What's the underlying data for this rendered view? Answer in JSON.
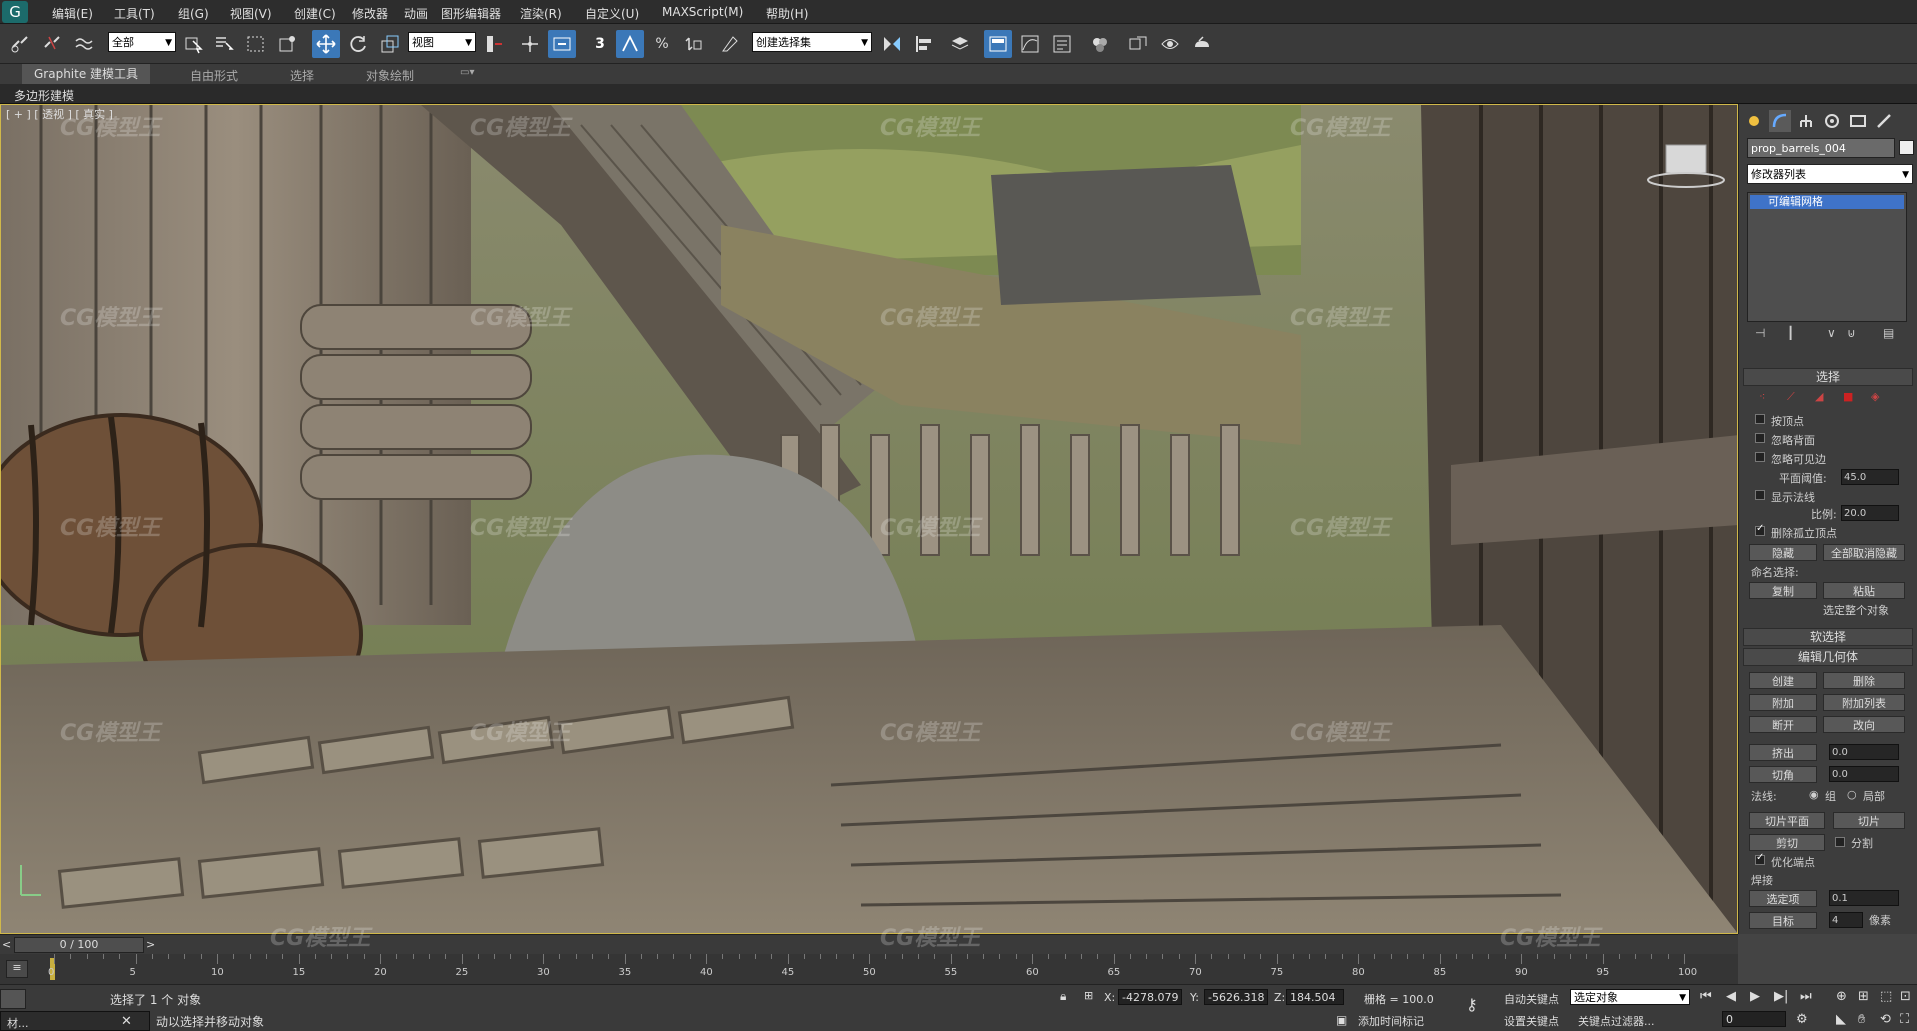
{
  "menubar": {
    "logo": "G",
    "items": [
      "编辑(E)",
      "工具(T)",
      "组(G)",
      "视图(V)",
      "创建(C)",
      "修改器",
      "动画",
      "图形编辑器",
      "渲染(R)",
      "自定义(U)",
      "MAXScript(M)",
      "帮助(H)"
    ]
  },
  "toolbar": {
    "filter_value": "全部",
    "refcoord_value": "视图",
    "named_selection_value": "创建选择集",
    "snap_label": "3"
  },
  "ribbon": {
    "tabs": [
      "Graphite 建模工具",
      "自由形式",
      "选择",
      "对象绘制"
    ],
    "subtab": "多边形建模"
  },
  "viewport": {
    "label": "[ + ] [ 透视 ] [ 真实 ]"
  },
  "watermark": "CG模型王",
  "command_panel": {
    "object_name": "prop_barrels_004",
    "modifier_list": "修改器列表",
    "stack_item": "可编辑网格",
    "selection_rollout": "选择",
    "selection": {
      "by_vertex": "按顶点",
      "ignore_backfacing": "忽略背面",
      "ignore_visible_edges": "忽略可见边",
      "planar_threshold_label": "平面阈值:",
      "planar_threshold": "45.0",
      "show_normals": "显示法线",
      "scale_label": "比例:",
      "scale": "20.0",
      "delete_isolated": "删除孤立顶点",
      "hide": "隐藏",
      "unhide_all": "全部取消隐藏",
      "named_sel_label": "命名选择:",
      "copy": "复制",
      "paste": "粘贴",
      "select_whole": "选定整个对象"
    },
    "soft_selection_rollout": "软选择",
    "edit_geometry_rollout": "编辑几何体",
    "edit_geometry": {
      "create": "创建",
      "delete": "删除",
      "attach": "附加",
      "attach_list": "附加列表",
      "detach": "断开",
      "turn": "改向",
      "extrude": "挤出",
      "extrude_val": "0.0",
      "chamfer": "切角",
      "chamfer_val": "0.0",
      "normal_label": "法线:",
      "group": "组",
      "local": "局部",
      "slice_plane": "切片平面",
      "slice": "切片",
      "cut": "剪切",
      "split": "分割",
      "refine_ends": "优化端点",
      "weld_label": "焊接",
      "selected": "选定项",
      "selected_val": "0.1",
      "target": "目标",
      "target_val": "4",
      "pixels": "像素"
    }
  },
  "timeline": {
    "frame": "0 / 100",
    "ticks": [
      "0",
      "5",
      "10",
      "15",
      "20",
      "25",
      "30",
      "35",
      "40",
      "45",
      "50",
      "55",
      "60",
      "65",
      "70",
      "75",
      "80",
      "85",
      "90",
      "95",
      "100"
    ]
  },
  "status": {
    "selected": "选择了 1 个 对象",
    "prompt": "单击或单击并拖动以选择对象",
    "prompt_visible": "动以选择并移动对象",
    "x_label": "X:",
    "x": "-4278.079",
    "y_label": "Y:",
    "y": "-5626.318",
    "z_label": "Z:",
    "z": "184.504",
    "grid": "栅格 = 100.0",
    "auto_key": "自动关键点",
    "selected_obj": "选定对象",
    "set_key": "设置关键点",
    "key_filter": "关键点过滤器...",
    "add_time_tag": "添加时间标记",
    "frame_field": "0",
    "taskbar_item": "材..."
  }
}
